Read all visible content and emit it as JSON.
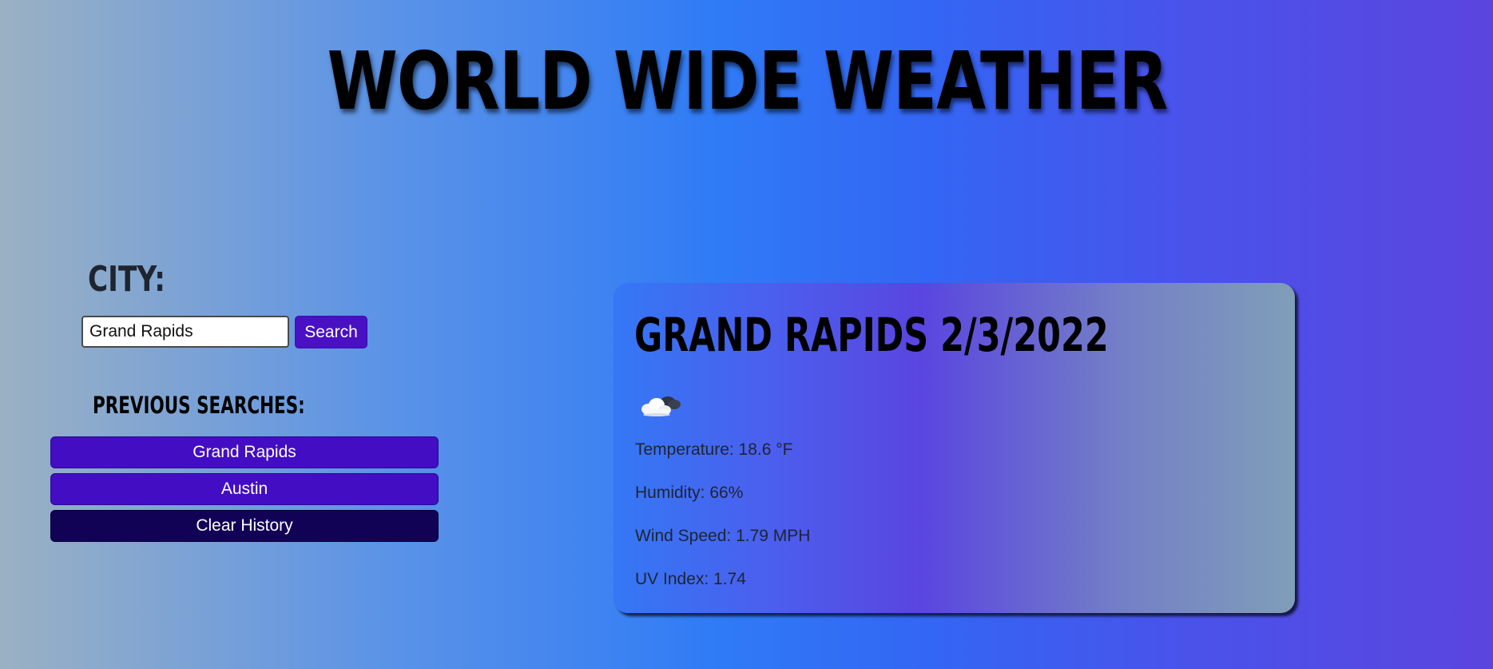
{
  "header": {
    "title": "World Wide Weather"
  },
  "search": {
    "label": "City:",
    "value": "Grand Rapids",
    "button_label": "Search"
  },
  "history": {
    "label": "Previous Searches:",
    "items": [
      "Grand Rapids",
      "Austin"
    ],
    "clear_label": "Clear History"
  },
  "current": {
    "title": "Grand Rapids 2/3/2022",
    "icon": "cloudy-night-icon",
    "temperature": "Temperature: 18.6 °F",
    "humidity": "Humidity: 66%",
    "wind": "Wind Speed: 1.79 MPH",
    "uv": "UV Index: 1.74"
  },
  "colors": {
    "primary_button": "#430dc4",
    "clear_button": "#120255",
    "title_text": "#000000"
  }
}
